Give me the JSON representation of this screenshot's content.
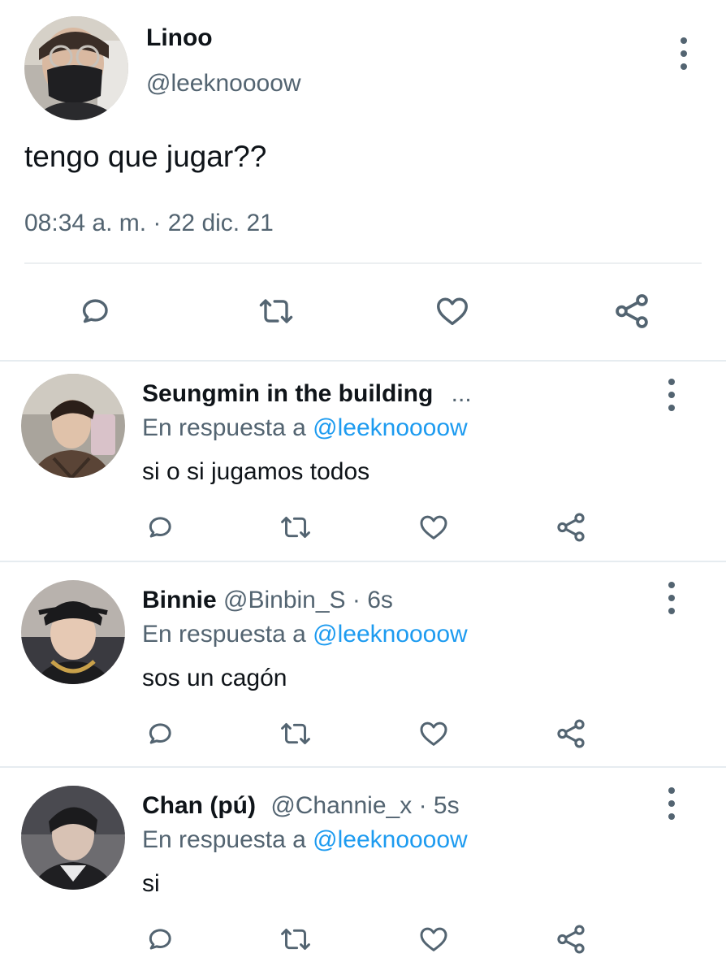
{
  "main_tweet": {
    "name": "Linoo",
    "handle": "@leeknoooow",
    "text": "tengo que jugar??",
    "timestamp": "08:34 a. m. · 22 dic. 21"
  },
  "replies": [
    {
      "name": "Seungmin in the building",
      "handle": "",
      "time": "...",
      "reply_prefix": "En respuesta a",
      "reply_mention": "@leeknoooow",
      "text": "si o si jugamos todos"
    },
    {
      "name": "Binnie",
      "handle": "@Binbin_S",
      "time": "· 6s",
      "reply_prefix": "En respuesta a",
      "reply_mention": "@leeknoooow",
      "text": "sos un cagón"
    },
    {
      "name": "Chan (pú)",
      "handle": "@Channie_x",
      "time": "· 5s",
      "reply_prefix": "En respuesta a",
      "reply_mention": "@leeknoooow",
      "text": "si"
    }
  ],
  "colors": {
    "text": "#0f1419",
    "secondary": "#536471",
    "link": "#1d9bf0",
    "divider": "#e6ecf0"
  },
  "icons": [
    "reply-icon",
    "retweet-icon",
    "like-icon",
    "share-icon",
    "more-options-icon"
  ]
}
